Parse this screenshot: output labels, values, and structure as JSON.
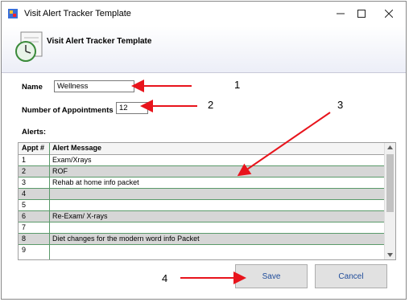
{
  "window": {
    "title": "Visit Alert Tracker Template"
  },
  "header": {
    "title": "Visit Alert Tracker Template"
  },
  "form": {
    "name_label": "Name",
    "name_value": "Wellness",
    "appointments_label": "Number of Appointments",
    "appointments_value": "12",
    "alerts_label": "Alerts:"
  },
  "grid": {
    "columns": [
      "Appt #",
      "Alert Message"
    ],
    "rows": [
      {
        "num": "1",
        "msg": "Exam/Xrays"
      },
      {
        "num": "2",
        "msg": "ROF"
      },
      {
        "num": "3",
        "msg": "Rehab at home info packet"
      },
      {
        "num": "4",
        "msg": ""
      },
      {
        "num": "5",
        "msg": ""
      },
      {
        "num": "6",
        "msg": "Re-Exam/ X-rays"
      },
      {
        "num": "7",
        "msg": ""
      },
      {
        "num": "8",
        "msg": "Diet changes for the modern word info Packet"
      },
      {
        "num": "9",
        "msg": ""
      }
    ]
  },
  "buttons": {
    "save": "Save",
    "cancel": "Cancel"
  },
  "annotations": [
    "1",
    "2",
    "3",
    "4"
  ],
  "colors": {
    "arrow": "#e8141c",
    "header_band": "#eceef7",
    "row_alt": "#d6d6d6",
    "grid_line": "#5a9a6a"
  }
}
